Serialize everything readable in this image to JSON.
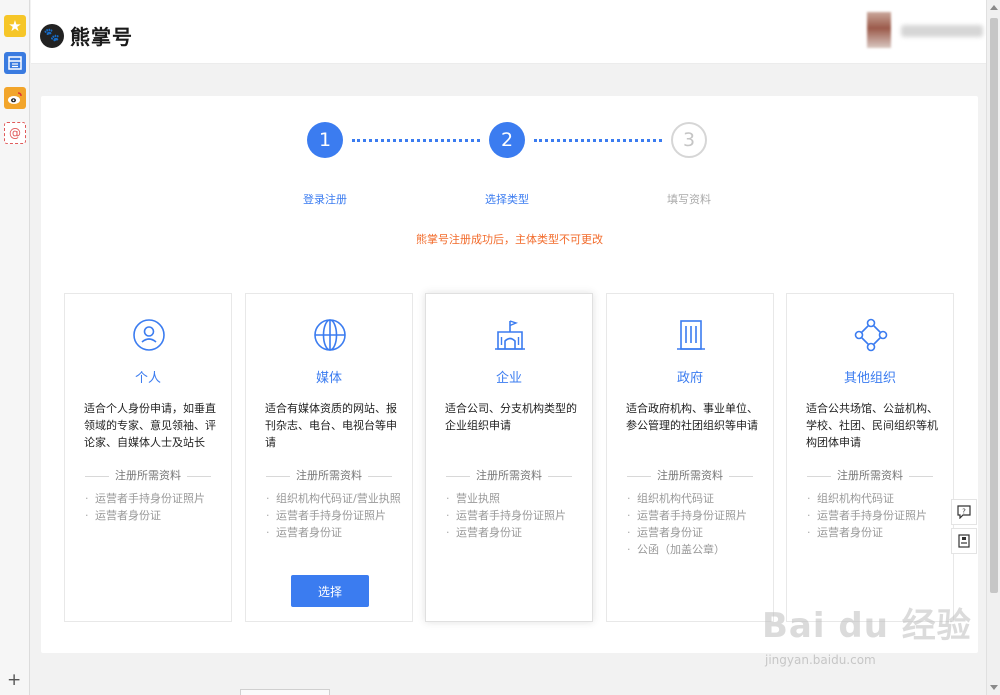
{
  "browser": {
    "sidebar_icons": [
      "star-icon",
      "notes-icon",
      "weibo-icon",
      "mail-icon"
    ],
    "mail_glyph": "@",
    "plus_glyph": "+"
  },
  "header": {
    "logo_glyph": "🐾",
    "logo_text": "熊掌号"
  },
  "steps": [
    {
      "number": "1",
      "label": "登录注册",
      "state": "active"
    },
    {
      "number": "2",
      "label": "选择类型",
      "state": "active"
    },
    {
      "number": "3",
      "label": "填写资料",
      "state": "inactive"
    }
  ],
  "notice": "熊掌号注册成功后，主体类型不可更改",
  "types": [
    {
      "icon": "person-icon",
      "title": "个人",
      "description": "适合个人身份申请，如垂直领域的专家、意见领袖、评论家、自媒体人士及站长",
      "requirements_title": "注册所需资料",
      "requirements": [
        "运营者手持身份证照片",
        "运营者身份证"
      ]
    },
    {
      "icon": "globe-icon",
      "title": "媒体",
      "description": "适合有媒体资质的网站、报刊杂志、电台、电视台等申请",
      "requirements_title": "注册所需资料",
      "requirements": [
        "组织机构代码证/营业执照",
        "运营者手持身份证照片",
        "运营者身份证"
      ],
      "button": "选择"
    },
    {
      "icon": "building-icon",
      "title": "企业",
      "description": "适合公司、分支机构类型的企业组织申请",
      "requirements_title": "注册所需资料",
      "requirements": [
        "营业执照",
        "运营者手持身份证照片",
        "运营者身份证"
      ]
    },
    {
      "icon": "government-icon",
      "title": "政府",
      "description": "适合政府机构、事业单位、参公管理的社团组织等申请",
      "requirements_title": "注册所需资料",
      "requirements": [
        "组织机构代码证",
        "运营者手持身份证照片",
        "运营者身份证",
        "公函（加盖公章）"
      ]
    },
    {
      "icon": "network-icon",
      "title": "其他组织",
      "description": "适合公共场馆、公益机构、学校、社团、民间组织等机构团体申请",
      "requirements_title": "注册所需资料",
      "requirements": [
        "组织机构代码证",
        "运营者手持身份证照片",
        "运营者身份证"
      ]
    }
  ],
  "colors": {
    "accent": "#3b7cf0",
    "notice": "#f26b2b",
    "inactive": "#c5c5c5"
  },
  "watermark": {
    "main": "Bai du 经验",
    "sub": "jingyan.baidu.com"
  }
}
